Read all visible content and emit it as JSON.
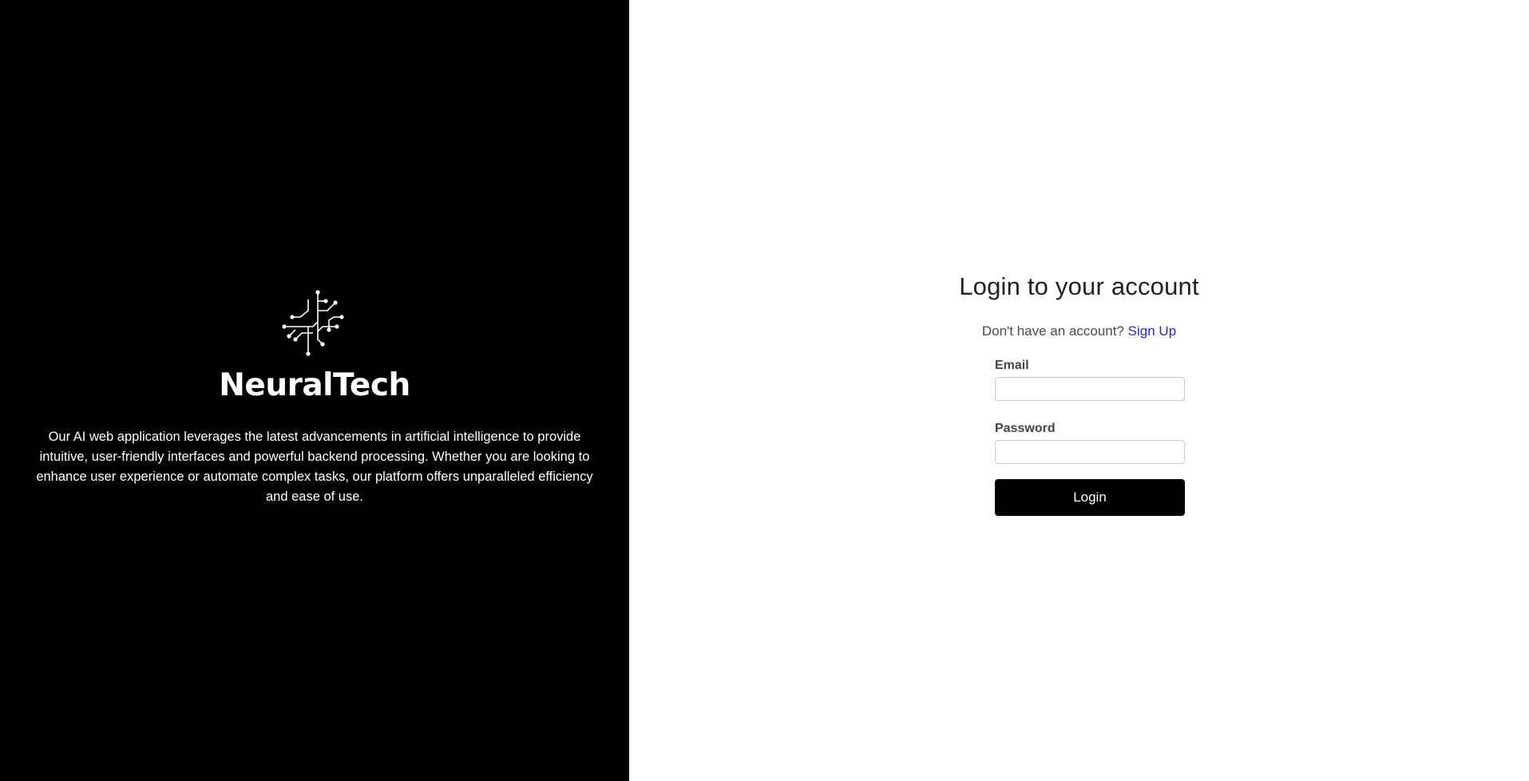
{
  "brand": {
    "logo_icon": "circuit-network-icon",
    "name": "NeuralTech",
    "description": "Our AI web application leverages the latest advancements in artificial intelligence to provide intuitive, user-friendly interfaces and powerful backend processing. Whether you are looking to enhance user experience or automate complex tasks, our platform offers unparalleled efficiency and ease of use."
  },
  "login": {
    "title": "Login to your account",
    "signup_prompt": "Don't have an account?",
    "signup_link": "Sign Up",
    "email_label": "Email",
    "email_value": "",
    "password_label": "Password",
    "password_value": "",
    "submit_label": "Login"
  },
  "colors": {
    "left_background": "#000000",
    "right_background": "#ffffff",
    "link": "#2b2bbf",
    "button": "#000000"
  }
}
